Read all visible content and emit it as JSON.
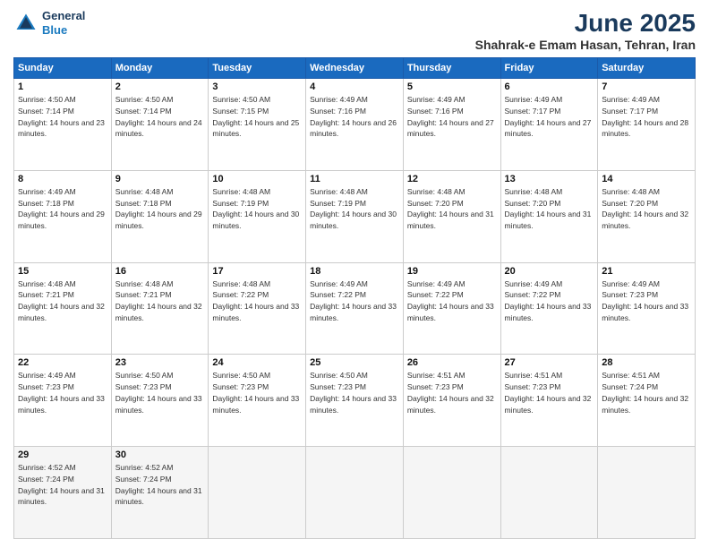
{
  "logo": {
    "line1": "General",
    "line2": "Blue"
  },
  "title": "June 2025",
  "subtitle": "Shahrak-e Emam Hasan, Tehran, Iran",
  "days_header": [
    "Sunday",
    "Monday",
    "Tuesday",
    "Wednesday",
    "Thursday",
    "Friday",
    "Saturday"
  ],
  "weeks": [
    [
      {
        "day": "1",
        "sunrise": "Sunrise: 4:50 AM",
        "sunset": "Sunset: 7:14 PM",
        "daylight": "Daylight: 14 hours and 23 minutes."
      },
      {
        "day": "2",
        "sunrise": "Sunrise: 4:50 AM",
        "sunset": "Sunset: 7:14 PM",
        "daylight": "Daylight: 14 hours and 24 minutes."
      },
      {
        "day": "3",
        "sunrise": "Sunrise: 4:50 AM",
        "sunset": "Sunset: 7:15 PM",
        "daylight": "Daylight: 14 hours and 25 minutes."
      },
      {
        "day": "4",
        "sunrise": "Sunrise: 4:49 AM",
        "sunset": "Sunset: 7:16 PM",
        "daylight": "Daylight: 14 hours and 26 minutes."
      },
      {
        "day": "5",
        "sunrise": "Sunrise: 4:49 AM",
        "sunset": "Sunset: 7:16 PM",
        "daylight": "Daylight: 14 hours and 27 minutes."
      },
      {
        "day": "6",
        "sunrise": "Sunrise: 4:49 AM",
        "sunset": "Sunset: 7:17 PM",
        "daylight": "Daylight: 14 hours and 27 minutes."
      },
      {
        "day": "7",
        "sunrise": "Sunrise: 4:49 AM",
        "sunset": "Sunset: 7:17 PM",
        "daylight": "Daylight: 14 hours and 28 minutes."
      }
    ],
    [
      {
        "day": "8",
        "sunrise": "Sunrise: 4:49 AM",
        "sunset": "Sunset: 7:18 PM",
        "daylight": "Daylight: 14 hours and 29 minutes."
      },
      {
        "day": "9",
        "sunrise": "Sunrise: 4:48 AM",
        "sunset": "Sunset: 7:18 PM",
        "daylight": "Daylight: 14 hours and 29 minutes."
      },
      {
        "day": "10",
        "sunrise": "Sunrise: 4:48 AM",
        "sunset": "Sunset: 7:19 PM",
        "daylight": "Daylight: 14 hours and 30 minutes."
      },
      {
        "day": "11",
        "sunrise": "Sunrise: 4:48 AM",
        "sunset": "Sunset: 7:19 PM",
        "daylight": "Daylight: 14 hours and 30 minutes."
      },
      {
        "day": "12",
        "sunrise": "Sunrise: 4:48 AM",
        "sunset": "Sunset: 7:20 PM",
        "daylight": "Daylight: 14 hours and 31 minutes."
      },
      {
        "day": "13",
        "sunrise": "Sunrise: 4:48 AM",
        "sunset": "Sunset: 7:20 PM",
        "daylight": "Daylight: 14 hours and 31 minutes."
      },
      {
        "day": "14",
        "sunrise": "Sunrise: 4:48 AM",
        "sunset": "Sunset: 7:20 PM",
        "daylight": "Daylight: 14 hours and 32 minutes."
      }
    ],
    [
      {
        "day": "15",
        "sunrise": "Sunrise: 4:48 AM",
        "sunset": "Sunset: 7:21 PM",
        "daylight": "Daylight: 14 hours and 32 minutes."
      },
      {
        "day": "16",
        "sunrise": "Sunrise: 4:48 AM",
        "sunset": "Sunset: 7:21 PM",
        "daylight": "Daylight: 14 hours and 32 minutes."
      },
      {
        "day": "17",
        "sunrise": "Sunrise: 4:48 AM",
        "sunset": "Sunset: 7:22 PM",
        "daylight": "Daylight: 14 hours and 33 minutes."
      },
      {
        "day": "18",
        "sunrise": "Sunrise: 4:49 AM",
        "sunset": "Sunset: 7:22 PM",
        "daylight": "Daylight: 14 hours and 33 minutes."
      },
      {
        "day": "19",
        "sunrise": "Sunrise: 4:49 AM",
        "sunset": "Sunset: 7:22 PM",
        "daylight": "Daylight: 14 hours and 33 minutes."
      },
      {
        "day": "20",
        "sunrise": "Sunrise: 4:49 AM",
        "sunset": "Sunset: 7:22 PM",
        "daylight": "Daylight: 14 hours and 33 minutes."
      },
      {
        "day": "21",
        "sunrise": "Sunrise: 4:49 AM",
        "sunset": "Sunset: 7:23 PM",
        "daylight": "Daylight: 14 hours and 33 minutes."
      }
    ],
    [
      {
        "day": "22",
        "sunrise": "Sunrise: 4:49 AM",
        "sunset": "Sunset: 7:23 PM",
        "daylight": "Daylight: 14 hours and 33 minutes."
      },
      {
        "day": "23",
        "sunrise": "Sunrise: 4:50 AM",
        "sunset": "Sunset: 7:23 PM",
        "daylight": "Daylight: 14 hours and 33 minutes."
      },
      {
        "day": "24",
        "sunrise": "Sunrise: 4:50 AM",
        "sunset": "Sunset: 7:23 PM",
        "daylight": "Daylight: 14 hours and 33 minutes."
      },
      {
        "day": "25",
        "sunrise": "Sunrise: 4:50 AM",
        "sunset": "Sunset: 7:23 PM",
        "daylight": "Daylight: 14 hours and 33 minutes."
      },
      {
        "day": "26",
        "sunrise": "Sunrise: 4:51 AM",
        "sunset": "Sunset: 7:23 PM",
        "daylight": "Daylight: 14 hours and 32 minutes."
      },
      {
        "day": "27",
        "sunrise": "Sunrise: 4:51 AM",
        "sunset": "Sunset: 7:23 PM",
        "daylight": "Daylight: 14 hours and 32 minutes."
      },
      {
        "day": "28",
        "sunrise": "Sunrise: 4:51 AM",
        "sunset": "Sunset: 7:24 PM",
        "daylight": "Daylight: 14 hours and 32 minutes."
      }
    ],
    [
      {
        "day": "29",
        "sunrise": "Sunrise: 4:52 AM",
        "sunset": "Sunset: 7:24 PM",
        "daylight": "Daylight: 14 hours and 31 minutes."
      },
      {
        "day": "30",
        "sunrise": "Sunrise: 4:52 AM",
        "sunset": "Sunset: 7:24 PM",
        "daylight": "Daylight: 14 hours and 31 minutes."
      },
      null,
      null,
      null,
      null,
      null
    ]
  ]
}
